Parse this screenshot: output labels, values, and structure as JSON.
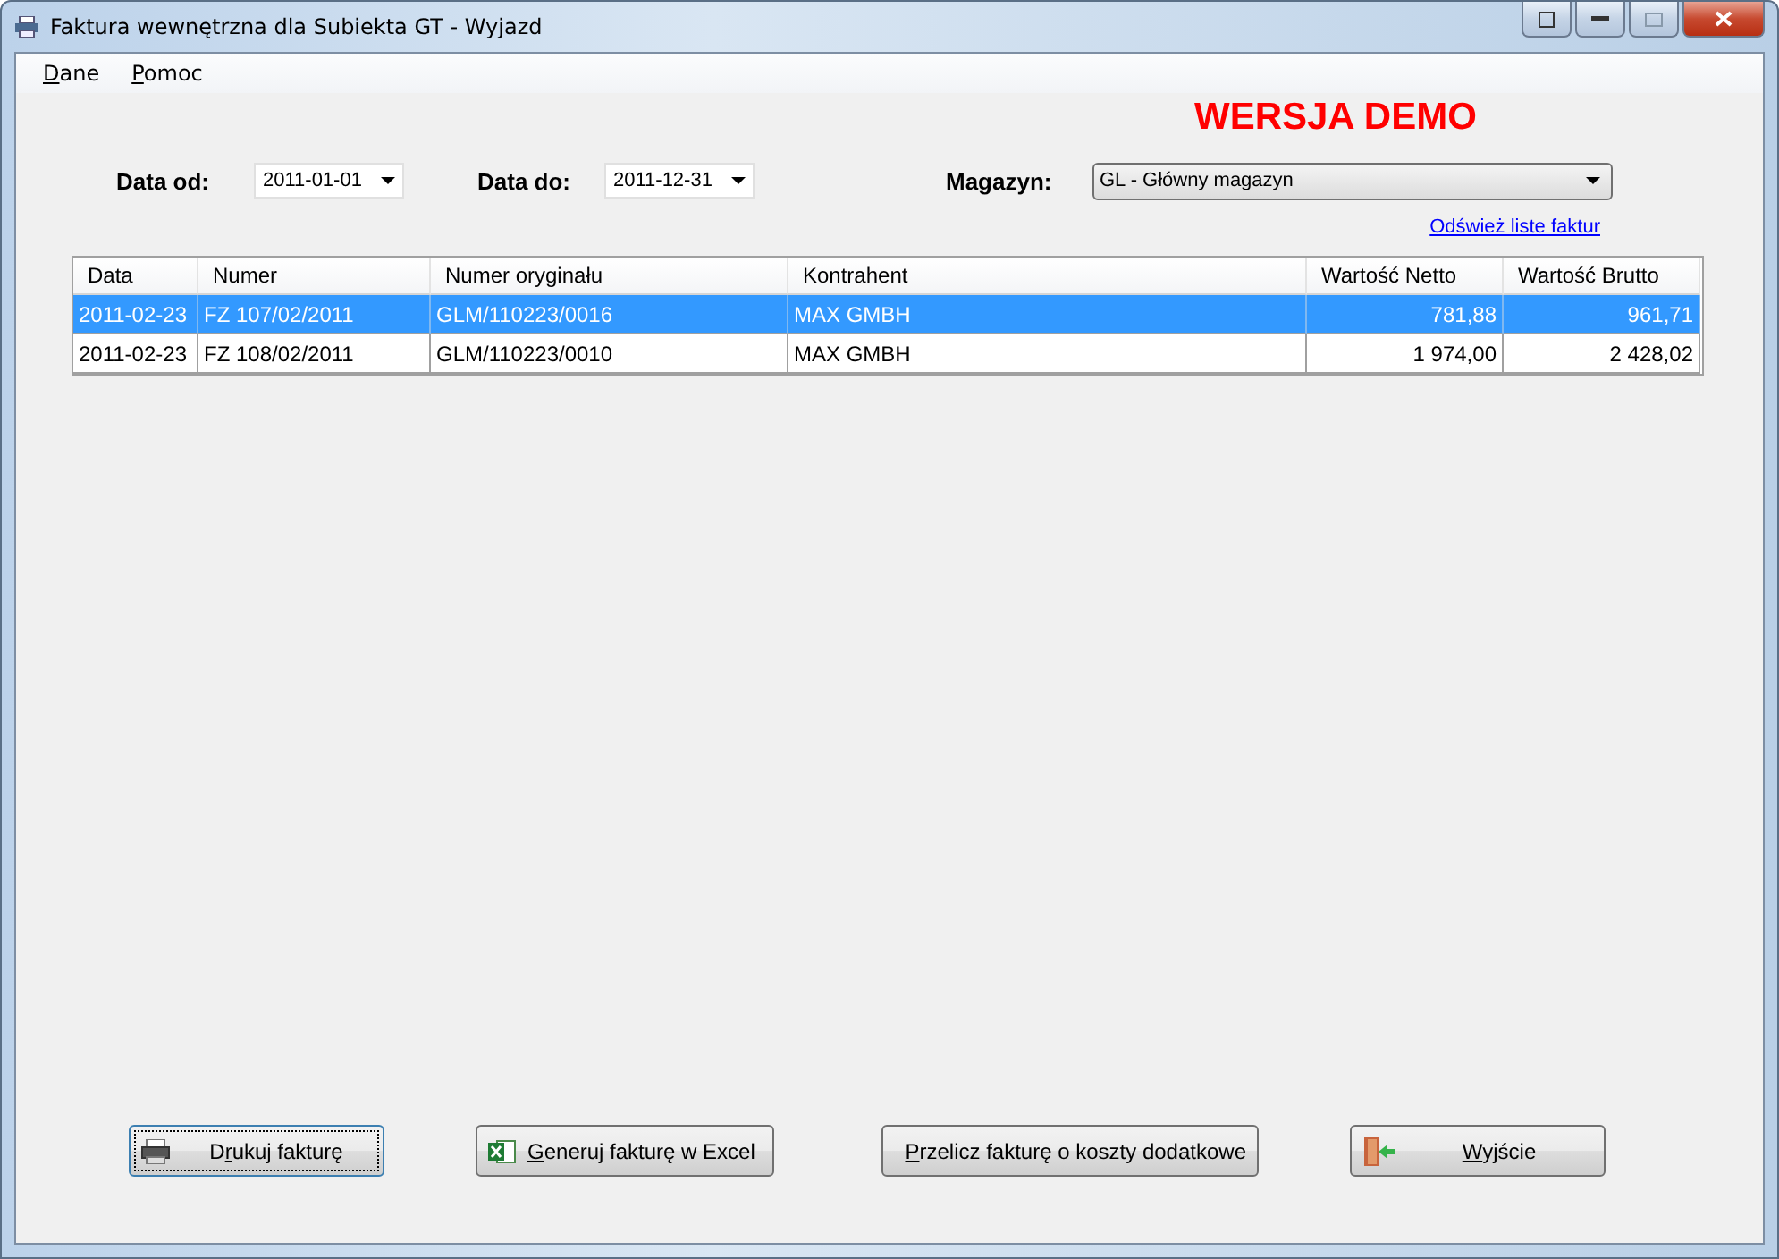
{
  "window": {
    "title": "Faktura wewnętrzna dla Subiekta GT - Wyjazd"
  },
  "menu": [
    {
      "key": "D",
      "post": "ane"
    },
    {
      "key": "P",
      "post": "omoc"
    }
  ],
  "banner": "WERSJA DEMO",
  "filters": {
    "date_from": {
      "label": "Data od:",
      "value": "2011-01-01"
    },
    "date_to": {
      "label": "Data do:",
      "value": "2011-12-31"
    },
    "warehouse": {
      "label": "Magazyn:",
      "value": "GL - Główny magazyn"
    }
  },
  "refresh_link": "Odśwież liste faktur",
  "table": {
    "columns": [
      "Data",
      "Numer",
      "Numer oryginału",
      "Kontrahent",
      "Wartość Netto",
      "Wartość Brutto"
    ],
    "rows": [
      {
        "selected": true,
        "cells": [
          "2011-02-23",
          "FZ 107/02/2011",
          "GLM/110223/0016",
          "MAX GMBH",
          "781,88",
          "961,71"
        ]
      },
      {
        "selected": false,
        "cells": [
          "2011-02-23",
          "FZ 108/02/2011",
          "GLM/110223/0010",
          "MAX GMBH",
          "1 974,00",
          "2 428,02"
        ]
      }
    ]
  },
  "buttons": [
    {
      "kind": "print",
      "pre": "D",
      "key": "r",
      "post": "ukuj fakturę",
      "focused": true
    },
    {
      "kind": "excel",
      "key": "G",
      "post": "eneruj fakturę w Excel",
      "focused": false
    },
    {
      "kind": "document",
      "key": "P",
      "post": "rzelicz fakturę o koszty dodatkowe",
      "focused": false
    },
    {
      "kind": "exit",
      "key": "W",
      "post": "yjście",
      "focused": false
    }
  ]
}
